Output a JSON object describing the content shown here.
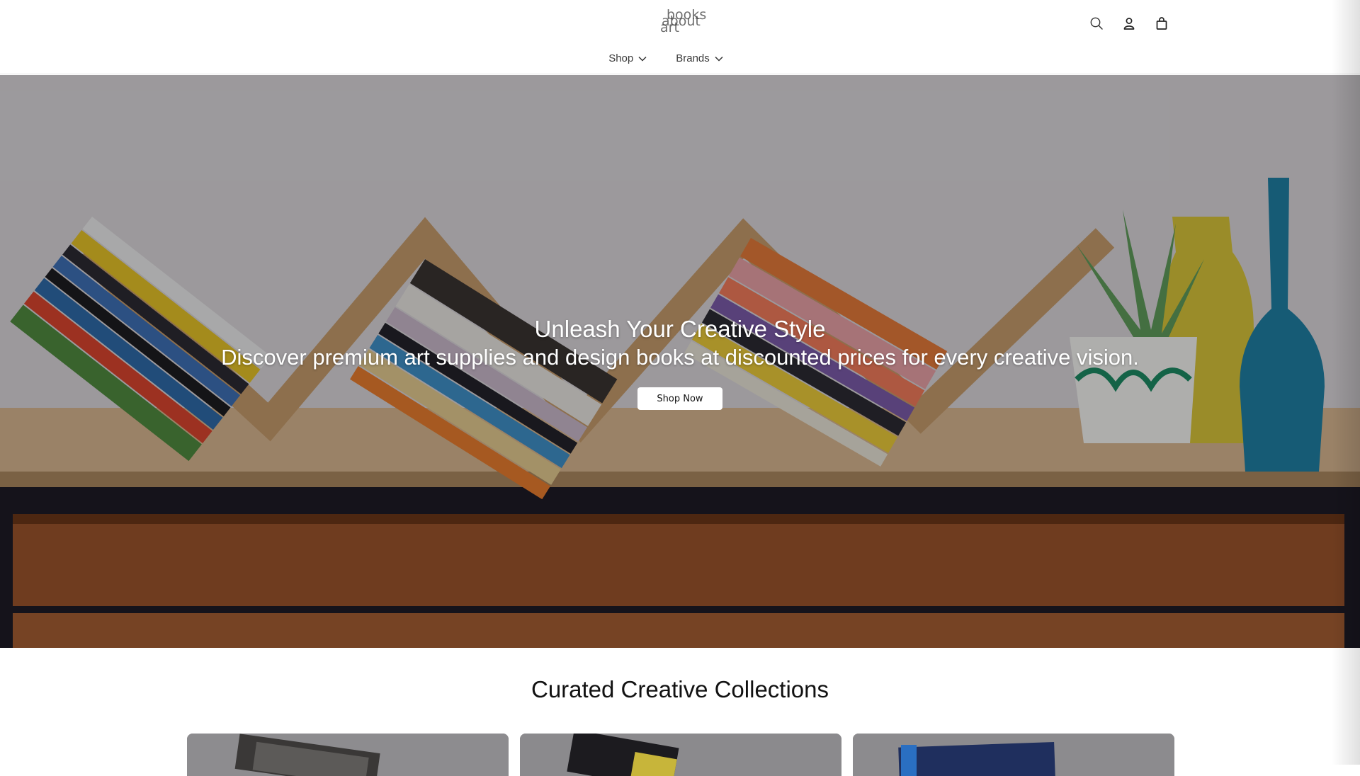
{
  "header": {
    "logo": {
      "line1": "books",
      "line2": "about",
      "line3": "art"
    },
    "icons": [
      "search-icon",
      "account-icon",
      "cart-icon"
    ]
  },
  "nav": {
    "items": [
      {
        "label": "Shop"
      },
      {
        "label": "Brands"
      }
    ]
  },
  "hero": {
    "title": "Unleash Your Creative Style",
    "subtitle": "Discover premium art supplies and design books at discounted prices for every creative vision.",
    "button_label": "Shop Now"
  },
  "collections": {
    "title": "Curated Creative Collections",
    "card_count": 3
  },
  "colors": {
    "wall": "#d9d6da",
    "shelf": "#c9a57a",
    "drawer": "#8a4a26",
    "vase_yellow": "#d8c23a",
    "vase_blue": "#1f7fa3"
  }
}
